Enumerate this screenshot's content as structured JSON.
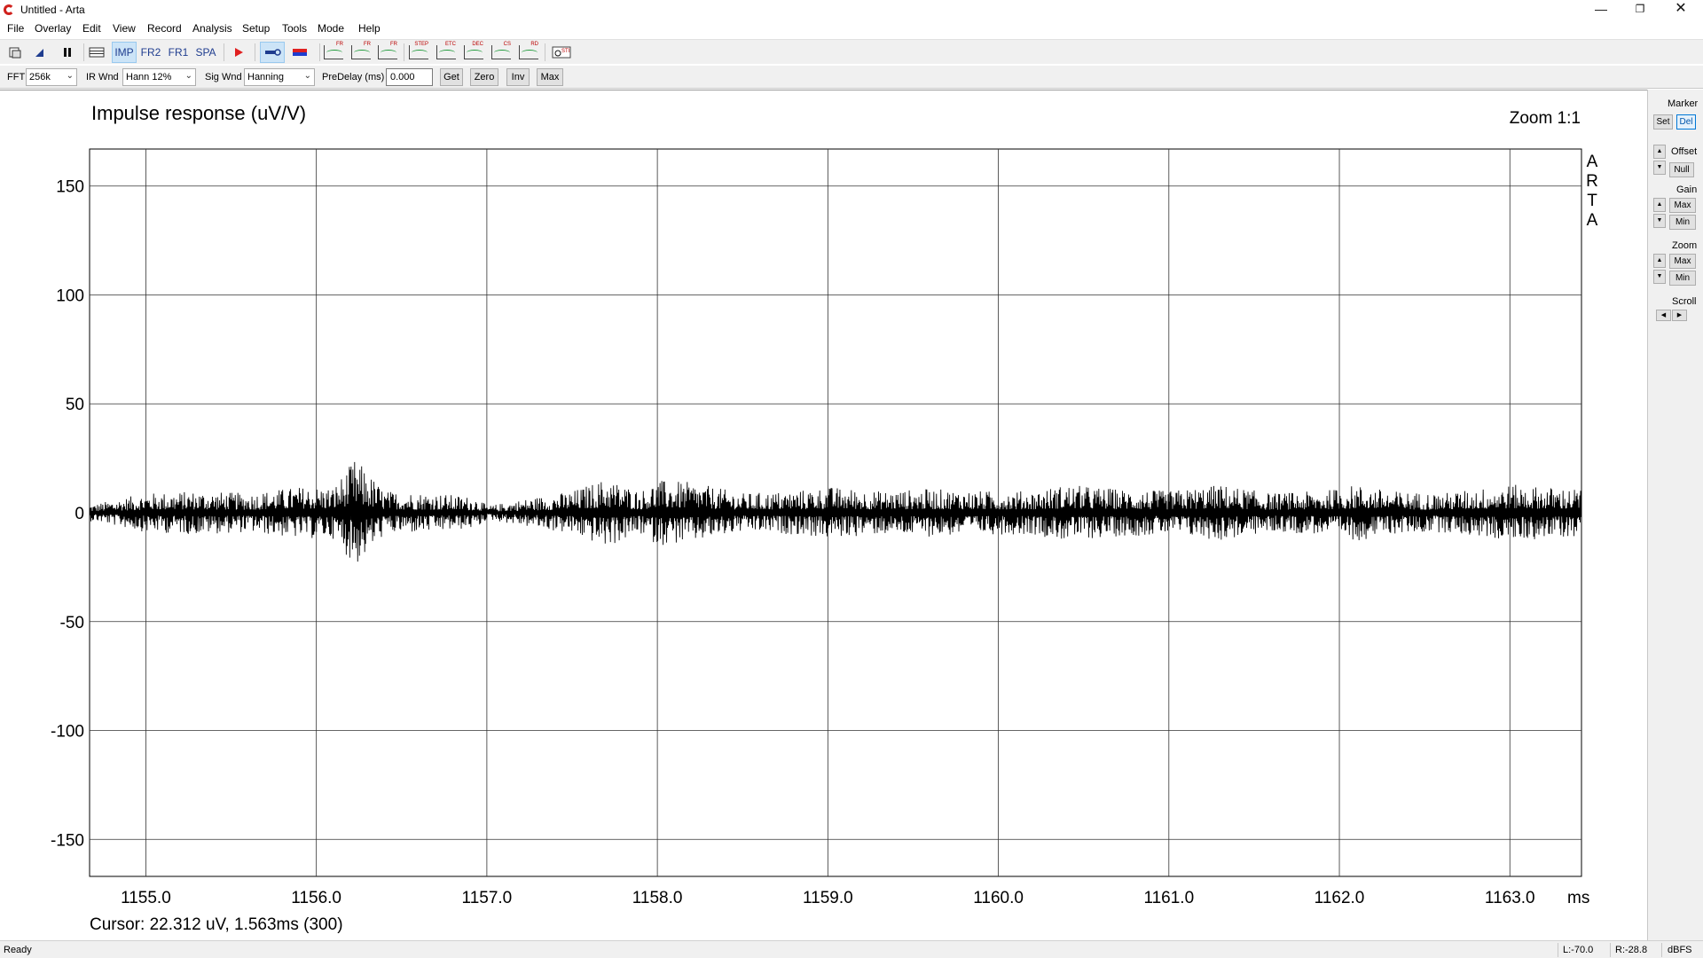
{
  "window": {
    "title": "Untitled - Arta"
  },
  "menu": [
    "File",
    "Overlay",
    "Edit",
    "View",
    "Record",
    "Analysis",
    "Setup",
    "Tools",
    "Mode",
    "Help"
  ],
  "toolbar": {
    "imp_label": "IMP",
    "fr2_label": "FR2",
    "fr1_label": "FR1",
    "spa_label": "SPA",
    "graph_buttons": [
      "FR",
      "FR",
      "FR",
      "STEP",
      "ETC",
      "DEC",
      "CS",
      "RD",
      "STI"
    ]
  },
  "params": {
    "fft_label": "FFT",
    "fft_value": "256k",
    "ir_wnd_label": "IR Wnd",
    "ir_wnd_value": "Hann 12%",
    "sig_wnd_label": "Sig Wnd",
    "sig_wnd_value": "Hanning",
    "predelay_label": "PreDelay (ms)",
    "predelay_value": "0.000",
    "get_label": "Get",
    "zero_label": "Zero",
    "inv_label": "Inv",
    "max_label": "Max"
  },
  "plot": {
    "title": "Impulse response (uV/V)",
    "zoom": "Zoom 1:1",
    "brand": "ARTA",
    "x_unit": "ms",
    "cursor": "Cursor: 22.312 uV, 1.563ms (300)"
  },
  "chart_data": {
    "type": "line",
    "title": "Impulse response (uV/V)",
    "xlabel": "ms",
    "ylabel": "",
    "xlim": [
      1154.67,
      1163.42
    ],
    "ylim": [
      -167,
      167
    ],
    "x_ticks": [
      1155.0,
      1156.0,
      1157.0,
      1158.0,
      1159.0,
      1160.0,
      1161.0,
      1162.0,
      1163.0
    ],
    "x_tick_labels": [
      "1155.0",
      "1156.0",
      "1157.0",
      "1158.0",
      "1159.0",
      "1160.0",
      "1161.0",
      "1162.0",
      "1163.0"
    ],
    "y_ticks": [
      150,
      100,
      50,
      0,
      -50,
      -100,
      -150
    ],
    "y_tick_labels": [
      "150",
      "100",
      "50",
      "0",
      "-50",
      "-100",
      "-150"
    ],
    "grid": true,
    "series": [
      {
        "color": "#000000",
        "note": "Noise-like impulse response oscillating around 0 with amplitude mostly within ±15, a peak near 1156.23 ms reaching about +25 / -23",
        "envelope_points": [
          [
            1154.7,
            4
          ],
          [
            1155.0,
            9
          ],
          [
            1155.3,
            10
          ],
          [
            1155.6,
            9
          ],
          [
            1155.9,
            12
          ],
          [
            1156.1,
            12
          ],
          [
            1156.23,
            25
          ],
          [
            1156.4,
            10
          ],
          [
            1156.7,
            9
          ],
          [
            1156.95,
            7
          ],
          [
            1157.0,
            3
          ],
          [
            1157.2,
            6
          ],
          [
            1157.5,
            10
          ],
          [
            1157.7,
            16
          ],
          [
            1157.9,
            10
          ],
          [
            1158.0,
            15
          ],
          [
            1158.2,
            14
          ],
          [
            1158.5,
            9
          ],
          [
            1158.8,
            10
          ],
          [
            1159.0,
            12
          ],
          [
            1159.3,
            10
          ],
          [
            1159.6,
            11
          ],
          [
            1159.9,
            10
          ],
          [
            1160.2,
            10
          ],
          [
            1160.4,
            13
          ],
          [
            1160.7,
            11
          ],
          [
            1161.0,
            10
          ],
          [
            1161.3,
            13
          ],
          [
            1161.6,
            9
          ],
          [
            1161.9,
            10
          ],
          [
            1162.1,
            13
          ],
          [
            1162.3,
            10
          ],
          [
            1162.6,
            9
          ],
          [
            1162.9,
            12
          ],
          [
            1163.0,
            13
          ],
          [
            1163.2,
            12
          ],
          [
            1163.42,
            11
          ]
        ]
      }
    ]
  },
  "sidepanel": {
    "marker_label": "Marker",
    "set_label": "Set",
    "del_label": "Del",
    "offset_label": "Offset",
    "null_label": "Null",
    "gain_label": "Gain",
    "gain_max": "Max",
    "gain_min": "Min",
    "zoom_label": "Zoom",
    "zoom_max": "Max",
    "zoom_min": "Min",
    "scroll_label": "Scroll"
  },
  "status": {
    "text": "Ready",
    "left_level": "L:-70.0",
    "right_level": "R:-28.8",
    "unit": "dBFS"
  }
}
